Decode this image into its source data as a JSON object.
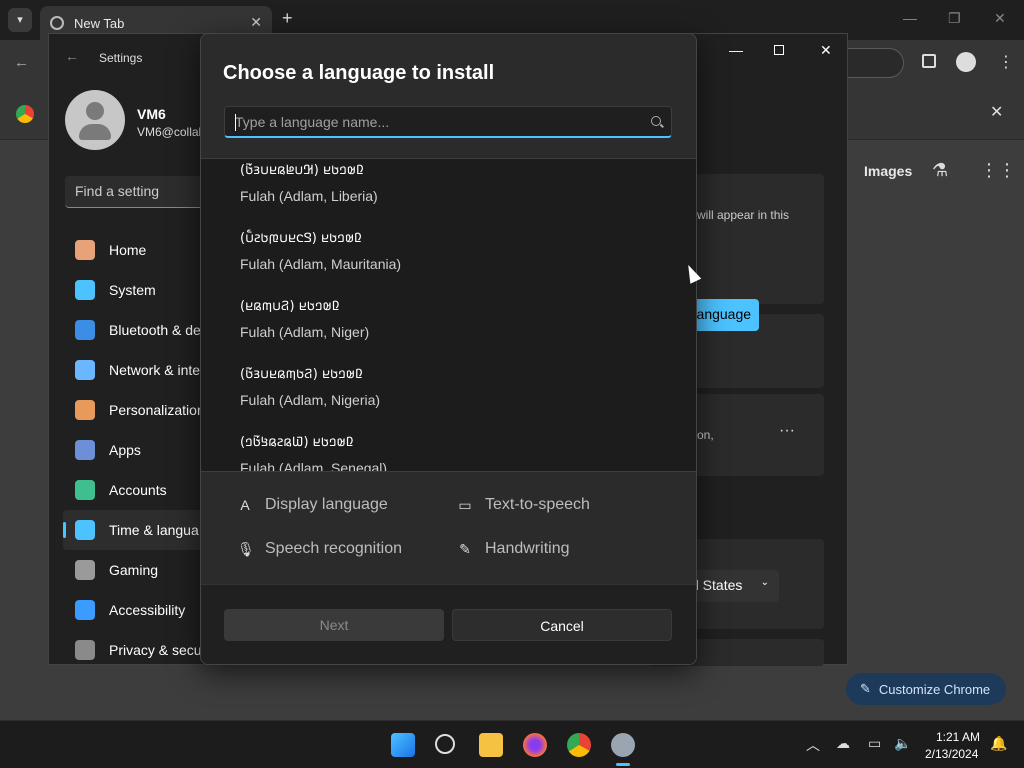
{
  "browser": {
    "tab_title": "New Tab",
    "images_link": "Images",
    "customize_label": "Customize Chrome"
  },
  "settings": {
    "window_title": "Settings",
    "user_name": "VM6",
    "user_email": "VM6@collal",
    "search_placeholder": "Find a setting",
    "nav": [
      {
        "label": "Home",
        "icon": "home-icon",
        "color": "#e8a27a"
      },
      {
        "label": "System",
        "icon": "system-icon",
        "color": "#4cc2ff"
      },
      {
        "label": "Bluetooth & de",
        "icon": "bluetooth-icon",
        "color": "#3a8ee6"
      },
      {
        "label": "Network & inte",
        "icon": "wifi-icon",
        "color": "#6ab7ff"
      },
      {
        "label": "Personalization",
        "icon": "brush-icon",
        "color": "#e89a5a"
      },
      {
        "label": "Apps",
        "icon": "apps-icon",
        "color": "#6c8fd8"
      },
      {
        "label": "Accounts",
        "icon": "accounts-icon",
        "color": "#3fbf8f"
      },
      {
        "label": "Time & langua",
        "icon": "globe-icon",
        "color": "#4cc2ff"
      },
      {
        "label": "Gaming",
        "icon": "gamepad-icon",
        "color": "#9a9a9a"
      },
      {
        "label": "Accessibility",
        "icon": "accessibility-icon",
        "color": "#3a9cff"
      },
      {
        "label": "Privacy & secu",
        "icon": "shield-icon",
        "color": "#8a8a8a"
      }
    ],
    "panel_text_1": "will appear in this",
    "add_language": "Add a language",
    "panel_text_2": "on,",
    "region_value": "d States"
  },
  "dialog": {
    "title": "Choose a language to install",
    "search_placeholder": "Type a language name...",
    "languages": [
      {
        "native": "(𞤂𞤭𞤦𞤫𞤪𞤭𞤴𞤢𞥄) 𞤆𞤵𞤤𞤢𞤪",
        "english": "Fulah (Adlam, Liberia)"
      },
      {
        "native": "(𞤃𞤮𞤪𞤭𞤼𞤢𞤲𞤭𞥅) 𞤆𞤵𞤤𞤢𞤪",
        "english": "Fulah (Adlam, Mauritania)"
      },
      {
        "native": "(𞤐𞤭𞤶𞤫𞤪) 𞤆𞤵𞤤𞤢𞤪",
        "english": "Fulah (Adlam, Niger)"
      },
      {
        "native": "(𞤐𞤢𞤶𞤫𞤪𞤭𞤴𞤢𞥄) 𞤆𞤵𞤤𞤢𞤪",
        "english": "Fulah (Adlam, Nigeria)"
      },
      {
        "native": "(𞤅𞤫𞤲𞤫𞤺𞤢𞥄𞤤) 𞤆𞤵𞤤𞤢𞤪",
        "english": "Fulah (Adlam, Senegal)"
      }
    ],
    "features": {
      "display": "Display language",
      "tts": "Text-to-speech",
      "speech": "Speech recognition",
      "handwriting": "Handwriting"
    },
    "next": "Next",
    "cancel": "Cancel"
  },
  "taskbar": {
    "time": "1:21 AM",
    "date": "2/13/2024",
    "accent": "#4cc2ff"
  }
}
